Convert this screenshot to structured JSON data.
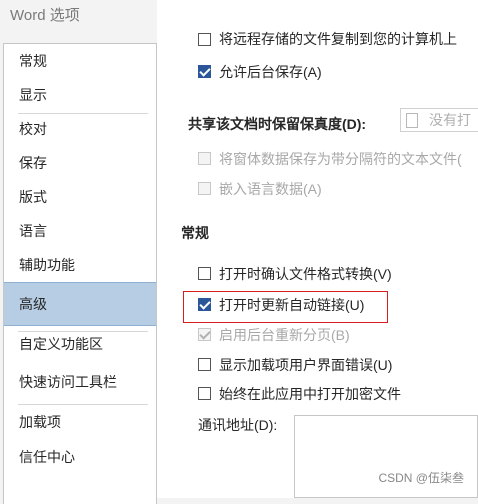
{
  "window": {
    "title": "Word 选项"
  },
  "sidebar": {
    "items": [
      {
        "label": "常规"
      },
      {
        "label": "显示"
      },
      {
        "label": "校对"
      },
      {
        "label": "保存"
      },
      {
        "label": "版式"
      },
      {
        "label": "语言"
      },
      {
        "label": "辅助功能"
      },
      {
        "label": "高级",
        "selected": true
      },
      {
        "label": "自定义功能区"
      },
      {
        "label": "快速访问工具栏"
      },
      {
        "label": "加载项"
      },
      {
        "label": "信任中心"
      }
    ]
  },
  "content": {
    "partial_top_label": "将远程存储的文件复制到您的计算机上",
    "allow_background_save": {
      "label": "允许后台保存(A)",
      "checked": true
    },
    "fidelity": {
      "heading": "共享该文档时保留保真度(D):",
      "doc_select_value": "没有打开",
      "save_form_data": {
        "label": "将窗体数据保存为带分隔符的文本文件(",
        "checked": false,
        "disabled": true
      },
      "embed_linguistic": {
        "label": "嵌入语言数据(A)",
        "checked": false,
        "disabled": true
      }
    },
    "general": {
      "heading": "常规",
      "confirm_conversion": {
        "label": "打开时确认文件格式转换(V)",
        "checked": false
      },
      "update_links": {
        "label": "打开时更新自动链接(U)",
        "checked": true
      },
      "background_repagination": {
        "label": "启用后台重新分页(B)",
        "checked": true,
        "disabled": true
      },
      "show_addin_errors": {
        "label": "显示加载项用户界面错误(U)",
        "checked": false
      },
      "always_open_encrypted": {
        "label": "始终在此应用中打开加密文件",
        "checked": false
      },
      "mailing_address_label": "通讯地址(D):"
    }
  },
  "watermark": "CSDN @伍柒叁",
  "colors": {
    "accent": "#2b579a",
    "selected_nav": "#b7cde4",
    "highlight": "#d81e1e"
  }
}
